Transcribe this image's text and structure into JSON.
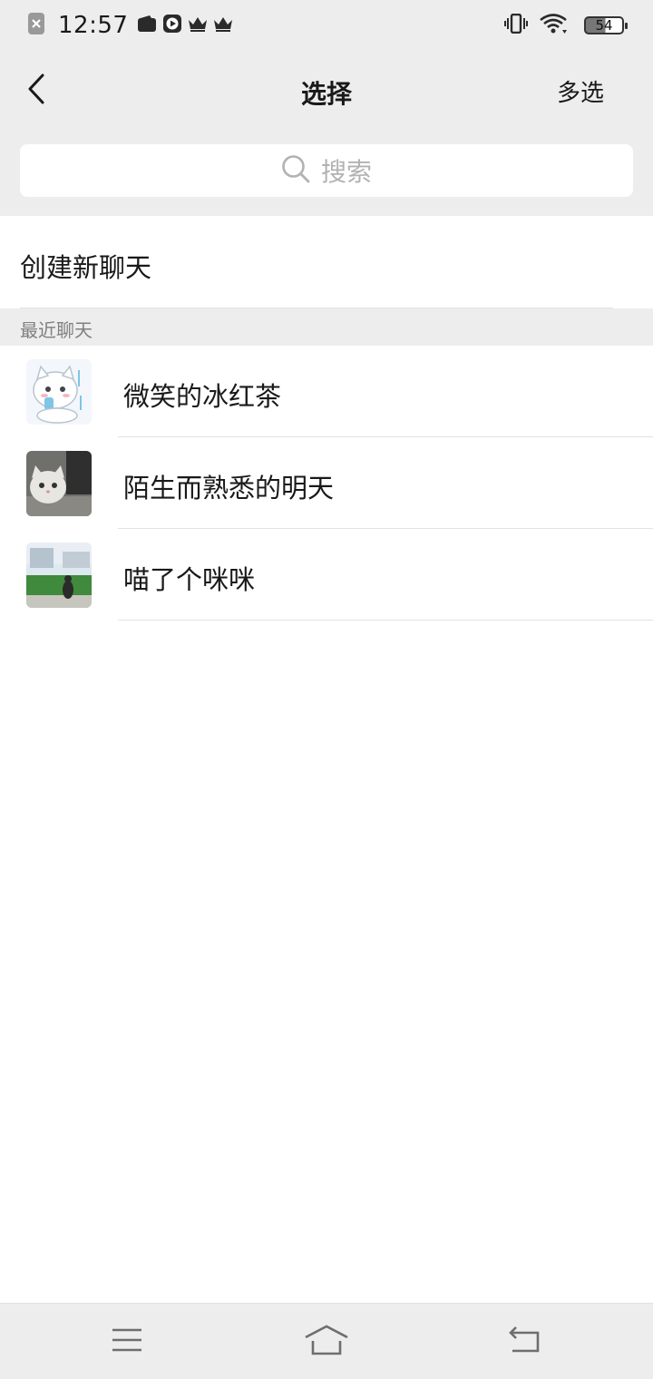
{
  "status_bar": {
    "time": "12:57",
    "battery": "54",
    "icons": [
      "close-notification-icon",
      "wallet-icon",
      "play-icon",
      "crown-icon",
      "crown-icon",
      "vibrate-icon",
      "wifi-icon",
      "battery-icon"
    ]
  },
  "header": {
    "back_icon": "back-arrow-icon",
    "title": "选择",
    "multi_select_label": "多选"
  },
  "search": {
    "icon": "search-icon",
    "placeholder": "搜索"
  },
  "new_chat": {
    "label": "创建新聊天"
  },
  "recent": {
    "header": "最近聊天",
    "items": [
      {
        "name": "微笑的冰红茶",
        "avatar": "cartoon-cat-avatar"
      },
      {
        "name": "陌生而熟悉的明天",
        "avatar": "kitten-photo-avatar"
      },
      {
        "name": "喵了个咪咪",
        "avatar": "outdoor-photo-avatar"
      }
    ]
  },
  "bottom_nav": {
    "icons": [
      "menu-icon",
      "home-icon",
      "back-icon"
    ]
  }
}
